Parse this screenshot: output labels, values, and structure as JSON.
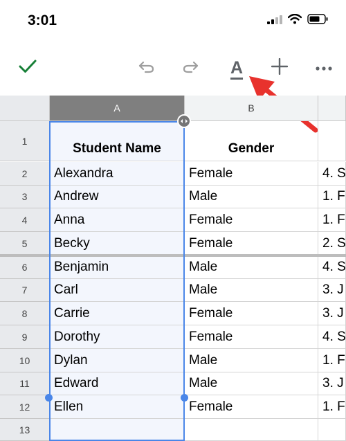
{
  "status": {
    "time": "3:01"
  },
  "toolbar": {
    "confirm_icon": "checkmark-icon",
    "undo_icon": "undo-icon",
    "redo_icon": "redo-icon",
    "format_icon": "text-format-icon",
    "format_label": "A",
    "insert_icon": "plus-icon",
    "more_icon": "more-icon"
  },
  "columns": {
    "a": "A",
    "b": "B"
  },
  "rows": [
    {
      "num": "1",
      "name": "Student Name",
      "gender": "Gender",
      "c": ""
    },
    {
      "num": "2",
      "name": "Alexandra",
      "gender": "Female",
      "c": "4. S"
    },
    {
      "num": "3",
      "name": "Andrew",
      "gender": "Male",
      "c": "1. F"
    },
    {
      "num": "4",
      "name": "Anna",
      "gender": "Female",
      "c": "1. F"
    },
    {
      "num": "5",
      "name": "Becky",
      "gender": "Female",
      "c": "2. S"
    },
    {
      "num": "6",
      "name": "Benjamin",
      "gender": "Male",
      "c": "4. S"
    },
    {
      "num": "7",
      "name": "Carl",
      "gender": "Male",
      "c": "3. J"
    },
    {
      "num": "8",
      "name": "Carrie",
      "gender": "Female",
      "c": "3. J"
    },
    {
      "num": "9",
      "name": "Dorothy",
      "gender": "Female",
      "c": "4. S"
    },
    {
      "num": "10",
      "name": "Dylan",
      "gender": "Male",
      "c": "1. F"
    },
    {
      "num": "11",
      "name": "Edward",
      "gender": "Male",
      "c": "3. J"
    },
    {
      "num": "12",
      "name": "Ellen",
      "gender": "Female",
      "c": "1. F"
    },
    {
      "num": "13",
      "name": "",
      "gender": "",
      "c": ""
    }
  ],
  "colors": {
    "accent": "#4a86e8",
    "check": "#188038",
    "arrow": "#e8322d"
  }
}
